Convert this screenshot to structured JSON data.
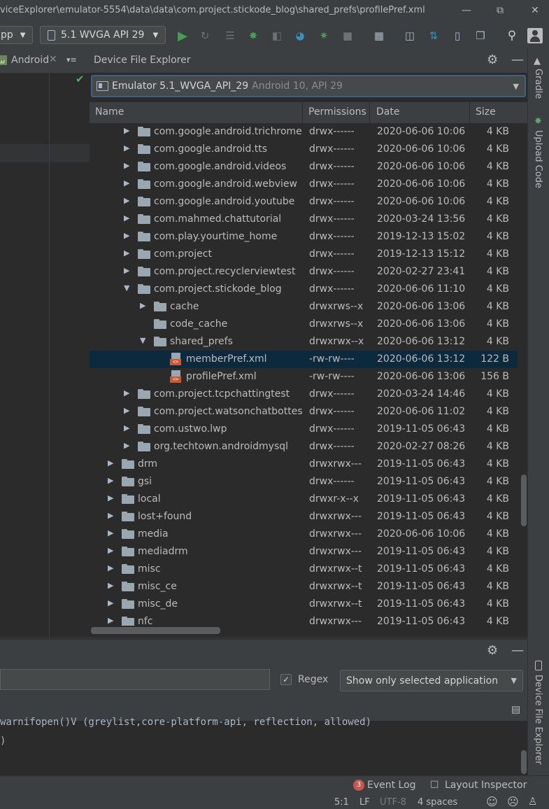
{
  "window": {
    "title": "viceExplorer\\emulator-5554\\data\\data\\com.project.stickode_blog\\shared_prefs\\profilePref.xml",
    "minimize_icon": "minimize-icon",
    "restore_icon": "restore-icon",
    "close_icon": "close-icon"
  },
  "toolbar": {
    "config_selector": "pp",
    "device_selector": "5.1  WVGA API 29",
    "icons": [
      "run-icon",
      "apply-changes-icon",
      "debug-list-icon",
      "debug-icon",
      "attach-debugger-icon",
      "profiler-icon",
      "stop-icon",
      "sync-icon",
      "project-structure-icon",
      "avd-manager-icon",
      "sdk-manager-icon",
      "device-manager-icon",
      "search-icon",
      "account-icon"
    ]
  },
  "left_panel": {
    "tab_label": "Android"
  },
  "device_file_explorer": {
    "title": "Device File Explorer",
    "device": {
      "name": "Emulator 5.1_WVGA_API_29",
      "detail": "Android 10, API 29"
    },
    "columns": {
      "name": "Name",
      "permissions": "Permissions",
      "date": "Date",
      "size": "Size"
    },
    "rows": [
      {
        "name": "com.google.android.trichromelibra",
        "perm": "drwx------",
        "date": "2020-06-06 10:06",
        "size": "4 KB",
        "level": 2,
        "type": "folder",
        "state": "collapsed"
      },
      {
        "name": "com.google.android.tts",
        "perm": "drwx------",
        "date": "2020-06-06 10:06",
        "size": "4 KB",
        "level": 2,
        "type": "folder",
        "state": "collapsed"
      },
      {
        "name": "com.google.android.videos",
        "perm": "drwx------",
        "date": "2020-06-06 10:06",
        "size": "4 KB",
        "level": 2,
        "type": "folder",
        "state": "collapsed"
      },
      {
        "name": "com.google.android.webview",
        "perm": "drwx------",
        "date": "2020-06-06 10:06",
        "size": "4 KB",
        "level": 2,
        "type": "folder",
        "state": "collapsed"
      },
      {
        "name": "com.google.android.youtube",
        "perm": "drwx------",
        "date": "2020-06-06 10:06",
        "size": "4 KB",
        "level": 2,
        "type": "folder",
        "state": "collapsed"
      },
      {
        "name": "com.mahmed.chattutorial",
        "perm": "drwx------",
        "date": "2020-03-24 13:56",
        "size": "4 KB",
        "level": 2,
        "type": "folder",
        "state": "collapsed"
      },
      {
        "name": "com.play.yourtime_home",
        "perm": "drwx------",
        "date": "2019-12-13 15:02",
        "size": "4 KB",
        "level": 2,
        "type": "folder",
        "state": "collapsed"
      },
      {
        "name": "com.project",
        "perm": "drwx------",
        "date": "2019-12-13 15:12",
        "size": "4 KB",
        "level": 2,
        "type": "folder",
        "state": "collapsed"
      },
      {
        "name": "com.project.recyclerviewtest",
        "perm": "drwx------",
        "date": "2020-02-27 23:41",
        "size": "4 KB",
        "level": 2,
        "type": "folder",
        "state": "collapsed"
      },
      {
        "name": "com.project.stickode_blog",
        "perm": "drwx------",
        "date": "2020-06-06 11:10",
        "size": "4 KB",
        "level": 2,
        "type": "folder",
        "state": "expanded"
      },
      {
        "name": "cache",
        "perm": "drwxrws--x",
        "date": "2020-06-06 13:06",
        "size": "4 KB",
        "level": 3,
        "type": "folder",
        "state": "collapsed"
      },
      {
        "name": "code_cache",
        "perm": "drwxrws--x",
        "date": "2020-06-06 13:06",
        "size": "4 KB",
        "level": 3,
        "type": "folder",
        "state": "none"
      },
      {
        "name": "shared_prefs",
        "perm": "drwxrwx--x",
        "date": "2020-06-06 13:12",
        "size": "4 KB",
        "level": 3,
        "type": "folder",
        "state": "expanded"
      },
      {
        "name": "memberPref.xml",
        "perm": "-rw-rw----",
        "date": "2020-06-06 13:12",
        "size": "122 B",
        "level": 4,
        "type": "xml",
        "state": "none",
        "selected": true
      },
      {
        "name": "profilePref.xml",
        "perm": "-rw-rw----",
        "date": "2020-06-06 13:06",
        "size": "156 B",
        "level": 4,
        "type": "xml",
        "state": "none"
      },
      {
        "name": "com.project.tcpchattingtest",
        "perm": "drwx------",
        "date": "2020-03-24 14:46",
        "size": "4 KB",
        "level": 2,
        "type": "folder",
        "state": "collapsed"
      },
      {
        "name": "com.project.watsonchatbottest",
        "perm": "drwx------",
        "date": "2020-06-06 11:02",
        "size": "4 KB",
        "level": 2,
        "type": "folder",
        "state": "collapsed"
      },
      {
        "name": "com.ustwo.lwp",
        "perm": "drwx------",
        "date": "2019-11-05 06:43",
        "size": "4 KB",
        "level": 2,
        "type": "folder",
        "state": "collapsed"
      },
      {
        "name": "org.techtown.androidmysql",
        "perm": "drwx------",
        "date": "2020-02-27 08:26",
        "size": "4 KB",
        "level": 2,
        "type": "folder",
        "state": "collapsed"
      },
      {
        "name": "drm",
        "perm": "drwxrwx---",
        "date": "2019-11-05 06:43",
        "size": "4 KB",
        "level": 1,
        "type": "folder",
        "state": "collapsed"
      },
      {
        "name": "gsi",
        "perm": "drwx------",
        "date": "2019-11-05 06:43",
        "size": "4 KB",
        "level": 1,
        "type": "folder",
        "state": "collapsed"
      },
      {
        "name": "local",
        "perm": "drwxr-x--x",
        "date": "2019-11-05 06:43",
        "size": "4 KB",
        "level": 1,
        "type": "folder",
        "state": "collapsed"
      },
      {
        "name": "lost+found",
        "perm": "drwxrwx---",
        "date": "2019-11-05 06:43",
        "size": "4 KB",
        "level": 1,
        "type": "folder",
        "state": "collapsed"
      },
      {
        "name": "media",
        "perm": "drwxrwx---",
        "date": "2020-06-06 10:06",
        "size": "4 KB",
        "level": 1,
        "type": "folder",
        "state": "collapsed"
      },
      {
        "name": "mediadrm",
        "perm": "drwxrwx---",
        "date": "2019-11-05 06:43",
        "size": "4 KB",
        "level": 1,
        "type": "folder",
        "state": "collapsed"
      },
      {
        "name": "misc",
        "perm": "drwxrwx--t",
        "date": "2019-11-05 06:43",
        "size": "4 KB",
        "level": 1,
        "type": "folder",
        "state": "collapsed"
      },
      {
        "name": "misc_ce",
        "perm": "drwxrwx--t",
        "date": "2019-11-05 06:43",
        "size": "4 KB",
        "level": 1,
        "type": "folder",
        "state": "collapsed"
      },
      {
        "name": "misc_de",
        "perm": "drwxrwx--t",
        "date": "2019-11-05 06:43",
        "size": "4 KB",
        "level": 1,
        "type": "folder",
        "state": "collapsed"
      },
      {
        "name": "nfc",
        "perm": "drwxrwx---",
        "date": "2019-11-05 06:43",
        "size": "4 KB",
        "level": 1,
        "type": "folder",
        "state": "collapsed"
      }
    ]
  },
  "right_strip": {
    "gradle": "Gradle",
    "upload_code": "Upload Code",
    "device_file_explorer": "Device File Explorer"
  },
  "logcat": {
    "regex_label": "Regex",
    "regex_checked": "✓",
    "app_filter": "Show only selected application",
    "log_lines": [
      "warnifopen()V (greylist,core-platform-api, reflection, allowed)",
      ")"
    ]
  },
  "statusbar": {
    "event_log_count": "3",
    "event_log": "Event Log",
    "layout_inspector": "Layout Inspector",
    "position": "5:1",
    "line_separator": "LF",
    "encoding": "UTF-8",
    "indent": "4 spaces"
  },
  "colors": {
    "accent": "#3d6185",
    "selection": "#0d293e",
    "run_green": "#499c54",
    "xml_orange": "#c9592f",
    "badge_red": "#c75450"
  }
}
